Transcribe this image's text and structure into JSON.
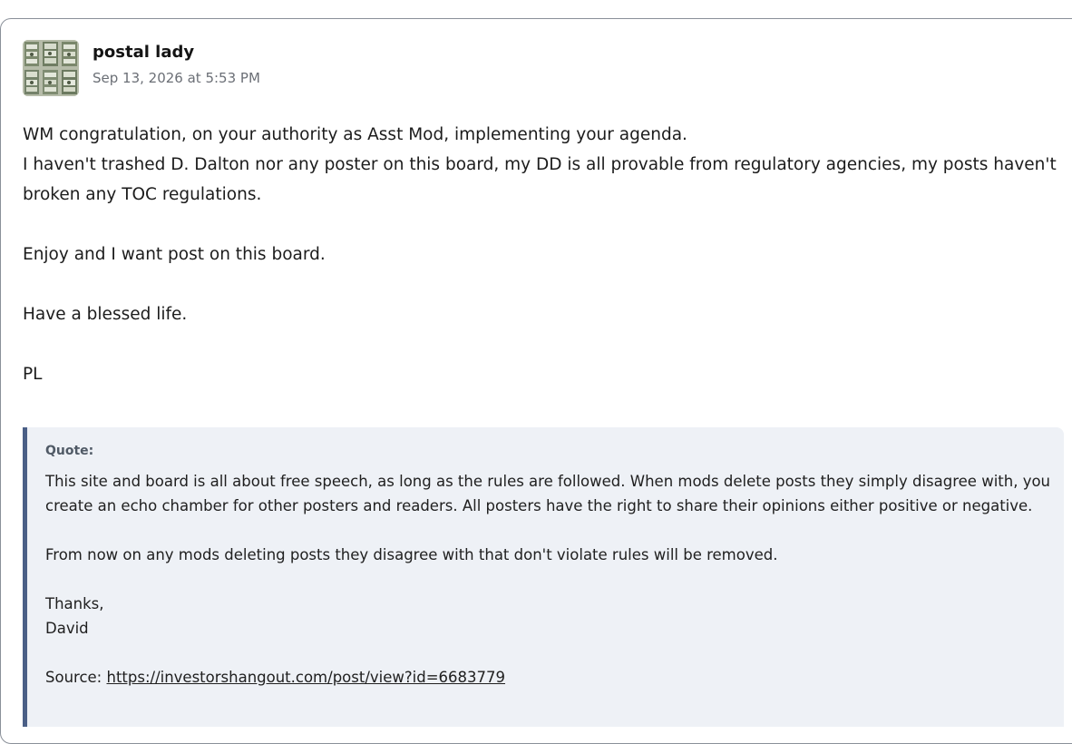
{
  "post": {
    "author": "postal lady",
    "timestamp": "Sep 13, 2026 at 5:53 PM",
    "avatar_icon": "money-stack-avatar",
    "body": [
      "WM congratulation, on your authority as Asst Mod, implementing your agenda.",
      "I haven't trashed D. Dalton nor any poster on this board, my DD is all provable from regulatory agencies, my posts haven't broken any TOC regulations.",
      "Enjoy and I want post on this board.",
      "Have a blessed life.",
      "PL"
    ]
  },
  "quote": {
    "label": "Quote:",
    "paragraph1": "This site and board is all about free speech, as long as the rules are followed. When mods delete posts they simply disagree with, you create an echo chamber for other posters and readers. All posters have the right to share their opinions either positive or negative.",
    "paragraph2": "From now on any mods deleting posts they disagree with that don't violate rules will be removed.",
    "signoff": "Thanks,",
    "signature": "David",
    "source_label": "Source:",
    "source_link": "https://investorshangout.com/post/view?id=6683779"
  },
  "colors": {
    "quote_background": "#eef1f6",
    "quote_border": "#4a5f86",
    "card_border": "#8a9099",
    "timestamp": "#6b6f76"
  }
}
